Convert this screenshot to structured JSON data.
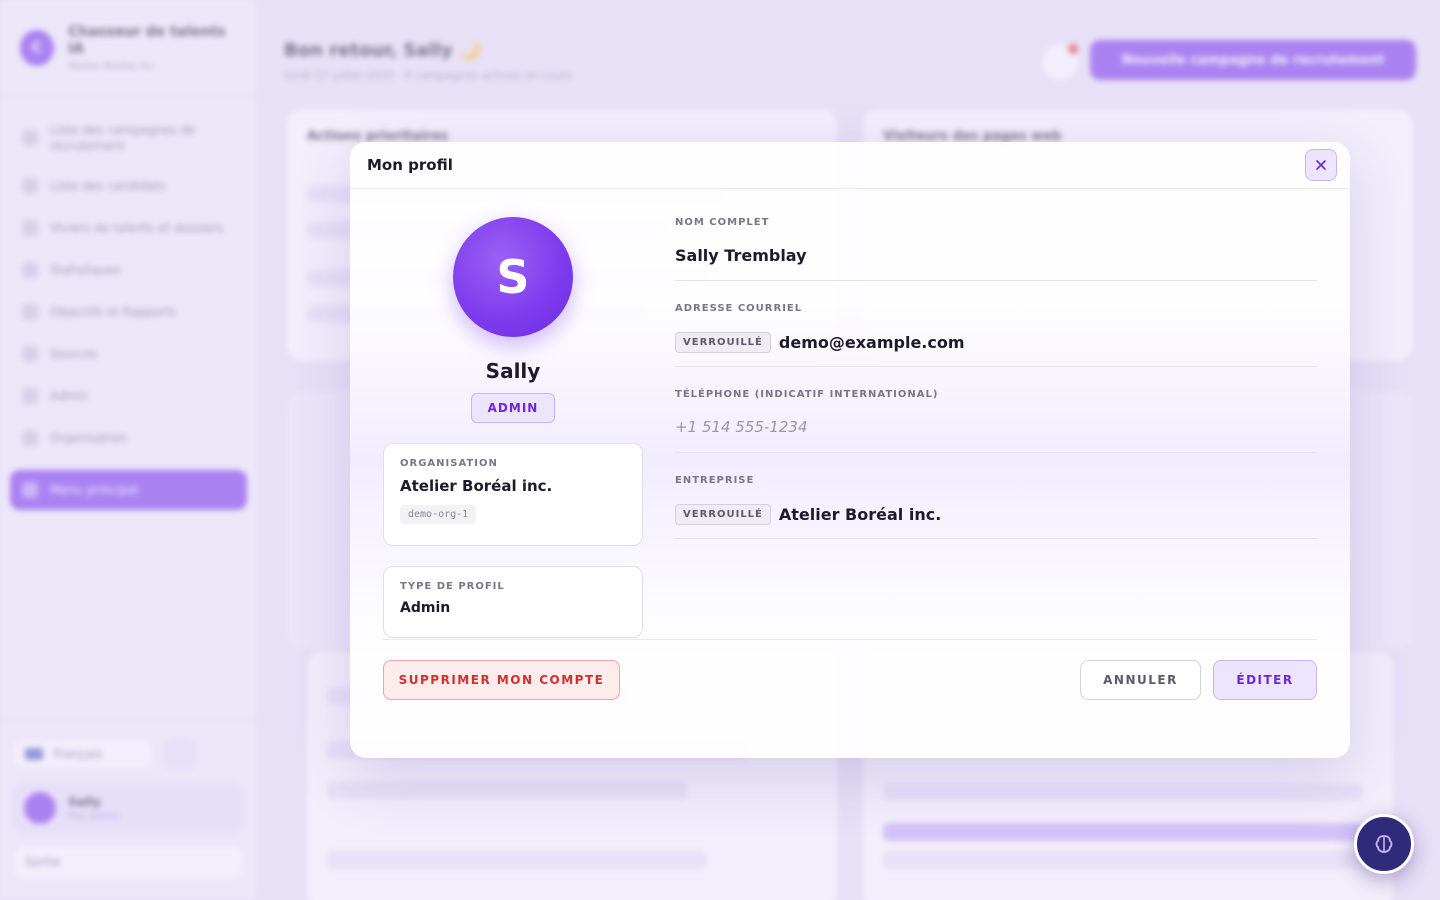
{
  "sidebar": {
    "brand_name": "Chasseur de talents IA",
    "brand_sub": "Atelier Boréal inc.",
    "items": [
      {
        "label": "Liste des campagnes de recrutement"
      },
      {
        "label": "Liste des candidats"
      },
      {
        "label": "Viviers de talents et dossiers"
      },
      {
        "label": "Statistiques"
      },
      {
        "label": "Objectifs et Rapports"
      },
      {
        "label": "Sources"
      },
      {
        "label": "Admin"
      },
      {
        "label": "Organisation"
      },
      {
        "label": "Menu principal"
      }
    ],
    "language": "Français",
    "user_name": "Sally",
    "user_role": "Pay Admin",
    "logout": "Sortie"
  },
  "main": {
    "greeting": "Bon retour, Sally 🌙",
    "greeting_sub": "lundi 27 juillet 2025 · 4 campagnes actives en cours",
    "cta": "Nouvelle campagne de recrutement",
    "card_actions_title": "Actions prioritaires",
    "card_visitors_title": "Visiteurs des pages web"
  },
  "modal": {
    "title": "Mon profil",
    "avatar_initial": "S",
    "display_name": "Sally",
    "role_badge": "ADMIN",
    "org_card": {
      "label": "ORGANISATION",
      "value": "Atelier Boréal inc.",
      "id": "demo-org-1"
    },
    "type_card": {
      "label": "TYPE DE PROFIL",
      "value": "Admin"
    },
    "fields": {
      "full_name": {
        "label": "NOM COMPLET",
        "value": "Sally Tremblay"
      },
      "email": {
        "label": "ADRESSE COURRIEL",
        "lock": "VERROUILLÉ",
        "value": "demo@example.com"
      },
      "phone": {
        "label": "TÉLÉPHONE (INDICATIF INTERNATIONAL)",
        "placeholder": "+1 514 555-1234"
      },
      "company": {
        "label": "ENTREPRISE",
        "lock": "VERROUILLÉ",
        "value": "Atelier Boréal inc."
      }
    },
    "buttons": {
      "delete": "SUPPRIMER MON COMPTE",
      "cancel": "ANNULER",
      "edit": "ÉDITER"
    }
  },
  "colors": {
    "accent": "#7c3aed",
    "danger": "#d32f2f",
    "fab": "#2f2a7a"
  }
}
